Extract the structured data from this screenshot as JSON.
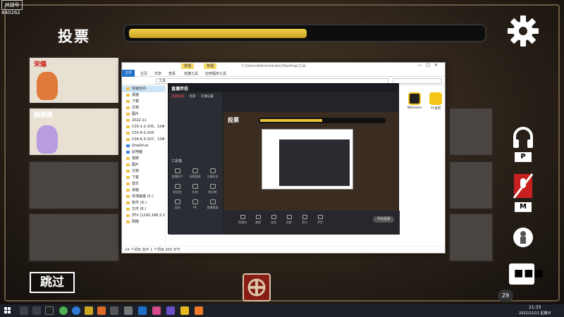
{
  "stream": {
    "logo_text": "对战号",
    "room_id": "840262"
  },
  "game": {
    "title": "投票",
    "timer_fraction": 0.5,
    "skip_label": "跳过",
    "players": [
      {
        "name": "宋爆",
        "color": "#e07a3a"
      },
      {
        "name": "鹅鹅鹅",
        "color": "#b89ce0"
      }
    ],
    "side_keys": {
      "listen": "P",
      "mute": "M"
    },
    "ping": "29"
  },
  "explorer": {
    "context_tabs": [
      "管理",
      "管理"
    ],
    "path_title": "C:\\Users\\Administrator\\Desktop\\工具",
    "ribbon_tabs": [
      "文件",
      "主页",
      "共享",
      "查看",
      "快捷工具",
      "应用程序工具"
    ],
    "address_path": "工具",
    "nav": [
      "快速访问",
      "桌面",
      "下载",
      "文档",
      "图片",
      "2022-11",
      "C03-1-2-105、10#",
      "C03-9-3-204",
      "C04-6-3-107、10#",
      "OneDrive",
      "此电脑",
      "视频",
      "图片",
      "文档",
      "下载",
      "音乐",
      "桌面",
      "本地磁盘 (C:)",
      "软件 (D:)",
      "文件 (E:)",
      "ZFX (\\\\192.168.3.2)",
      "网络"
    ],
    "status": "24 个项目    选中 1 个项目  656 字节",
    "desktop_icons": [
      {
        "label": "WeGame",
        "color": "#222"
      },
      {
        "label": "YY语音",
        "color": "#f5c518"
      }
    ]
  },
  "stream_app": {
    "name": "直播伴侣",
    "side_tabs": [
      "直播管理",
      "场景",
      "开播设置"
    ],
    "tools_label": "工具箱",
    "tools": [
      "直播助手",
      "场景管理",
      "主播任务",
      "粉丝团",
      "礼物",
      "粉丝榜",
      "连线",
      "PK",
      "直播数据"
    ],
    "bottom_tools": [
      "直播间",
      "美颜",
      "连线",
      "投屏",
      "音乐",
      "声音"
    ],
    "go_live": "开始直播"
  },
  "taskbar": {
    "time": "21:33",
    "date": "2022/12/11 星期日"
  }
}
